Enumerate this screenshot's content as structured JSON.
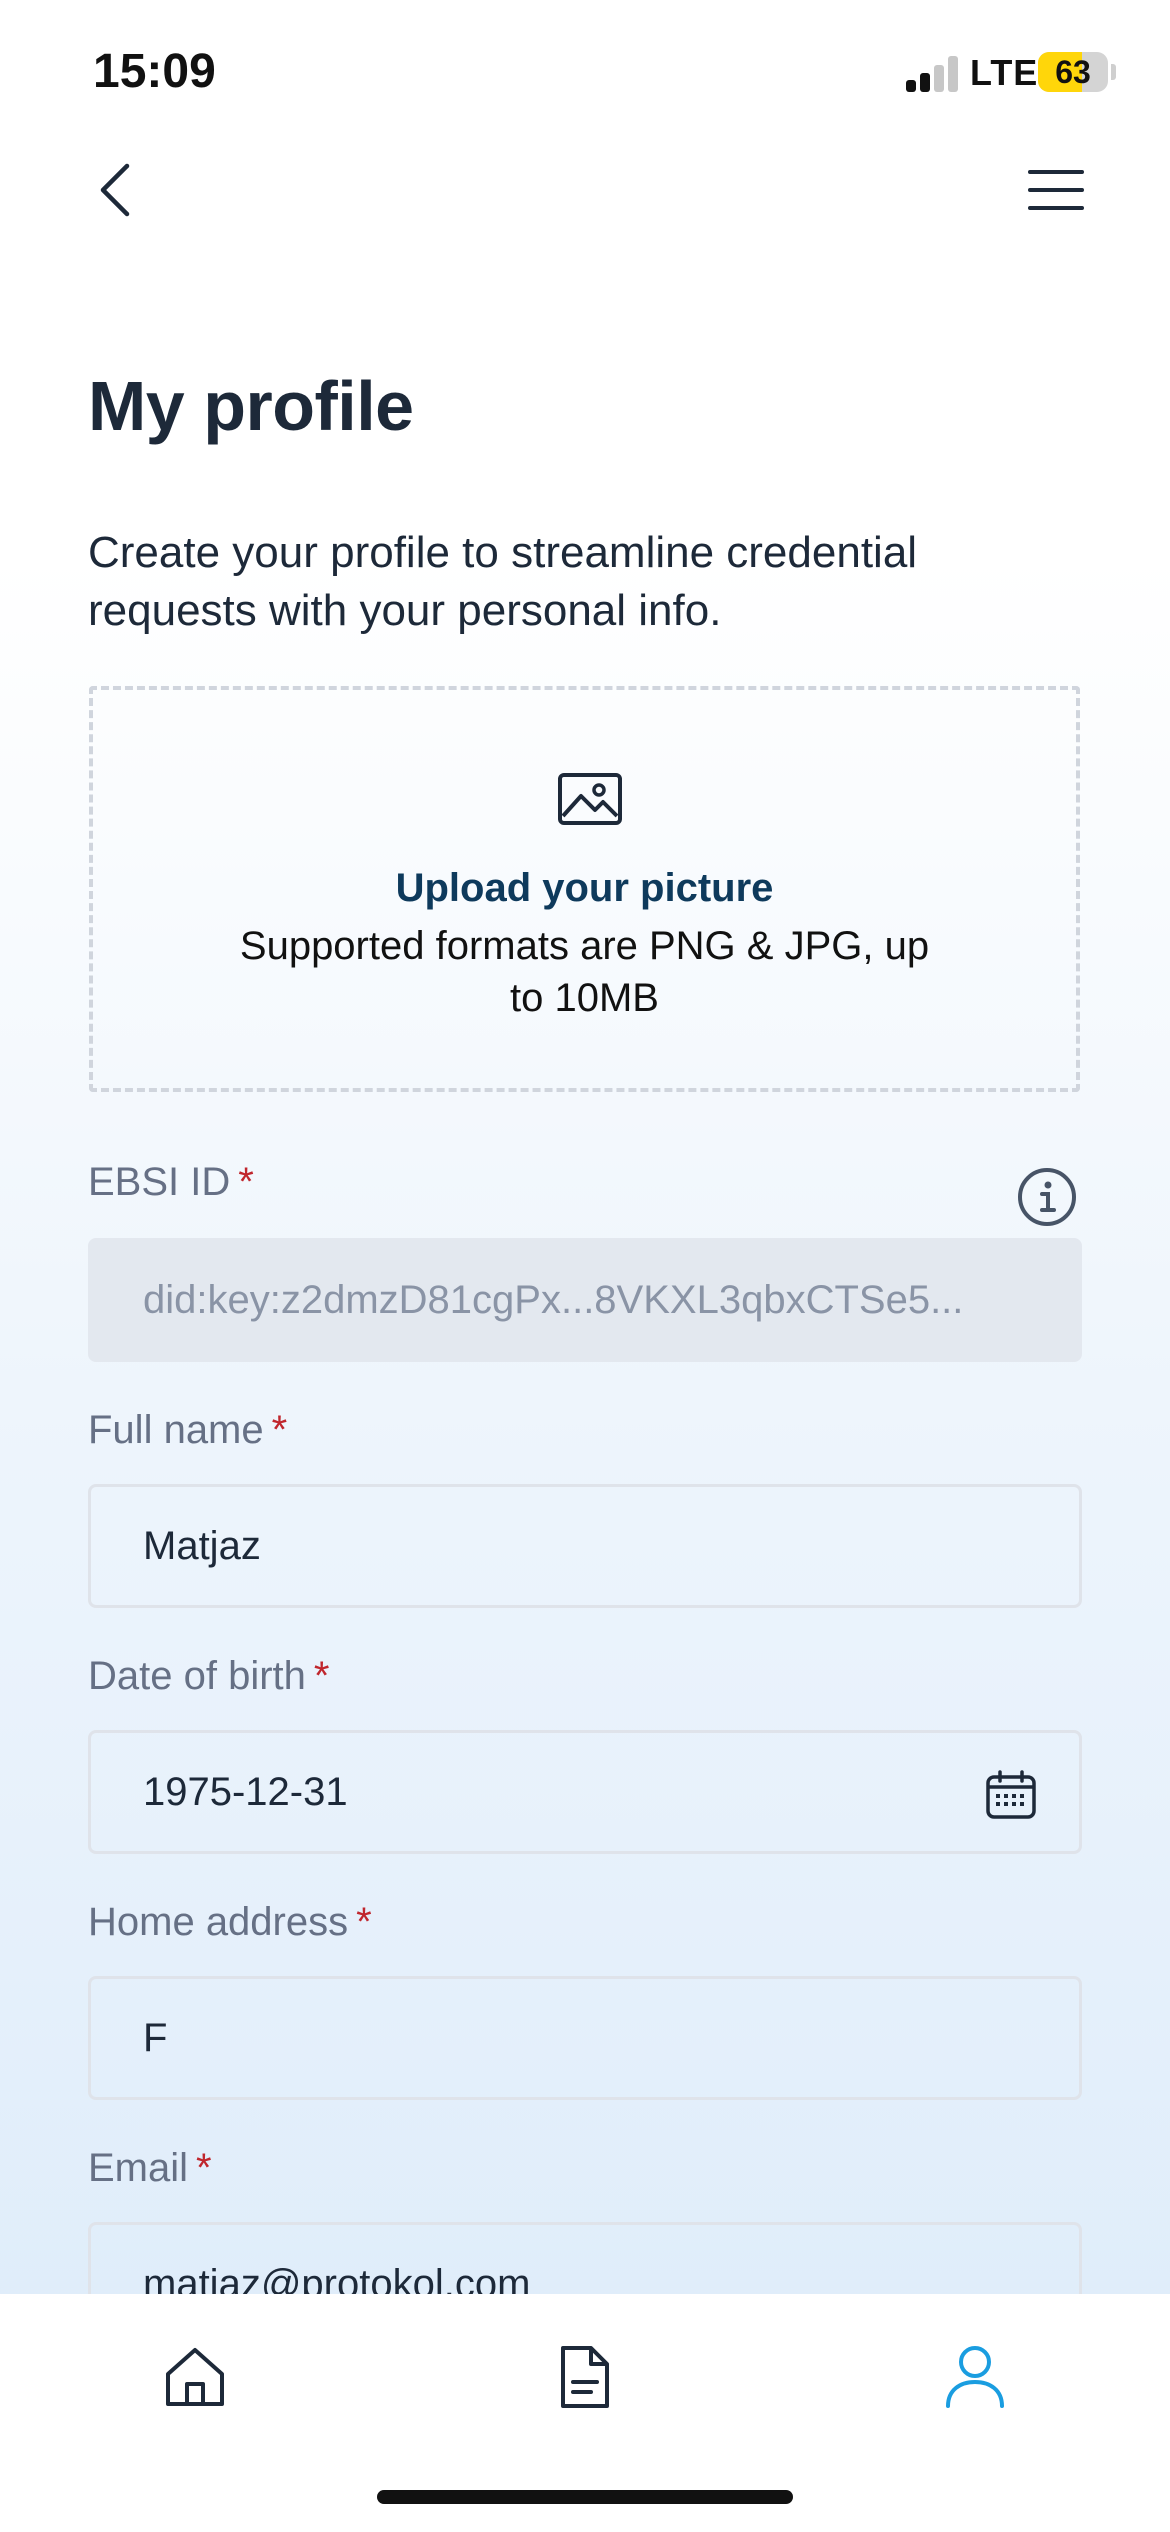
{
  "status_bar": {
    "time": "15:09",
    "network": "LTE",
    "battery": "63",
    "battery_level": 0.63
  },
  "page": {
    "title": "My profile",
    "subtitle": "Create your profile to streamline credential requests with your personal info."
  },
  "upload": {
    "title": "Upload your picture",
    "description": "Supported formats are PNG & JPG, up to 10MB"
  },
  "fields": {
    "ebsi_id": {
      "label": "EBSI ID",
      "required": "*",
      "value": "did:key:z2dmzD81cgPx...8VKXL3qbxCTSe5..."
    },
    "full_name": {
      "label": "Full name",
      "required": "*",
      "value": "Matjaz"
    },
    "date_of_birth": {
      "label": "Date of birth",
      "required": "*",
      "value": "1975-12-31"
    },
    "home_address": {
      "label": "Home address",
      "required": "*",
      "value": "F"
    },
    "email": {
      "label": "Email",
      "required": "*",
      "value": "matjaz@protokol.com"
    }
  },
  "tabs": [
    {
      "icon": "home-icon",
      "active": false
    },
    {
      "icon": "document-icon",
      "active": false
    },
    {
      "icon": "user-icon",
      "active": true
    }
  ],
  "colors": {
    "text": "#1d2939",
    "label": "#667085",
    "required": "#c0262d",
    "accent": "#1a9de0",
    "upload_title": "#0e3a5c"
  }
}
